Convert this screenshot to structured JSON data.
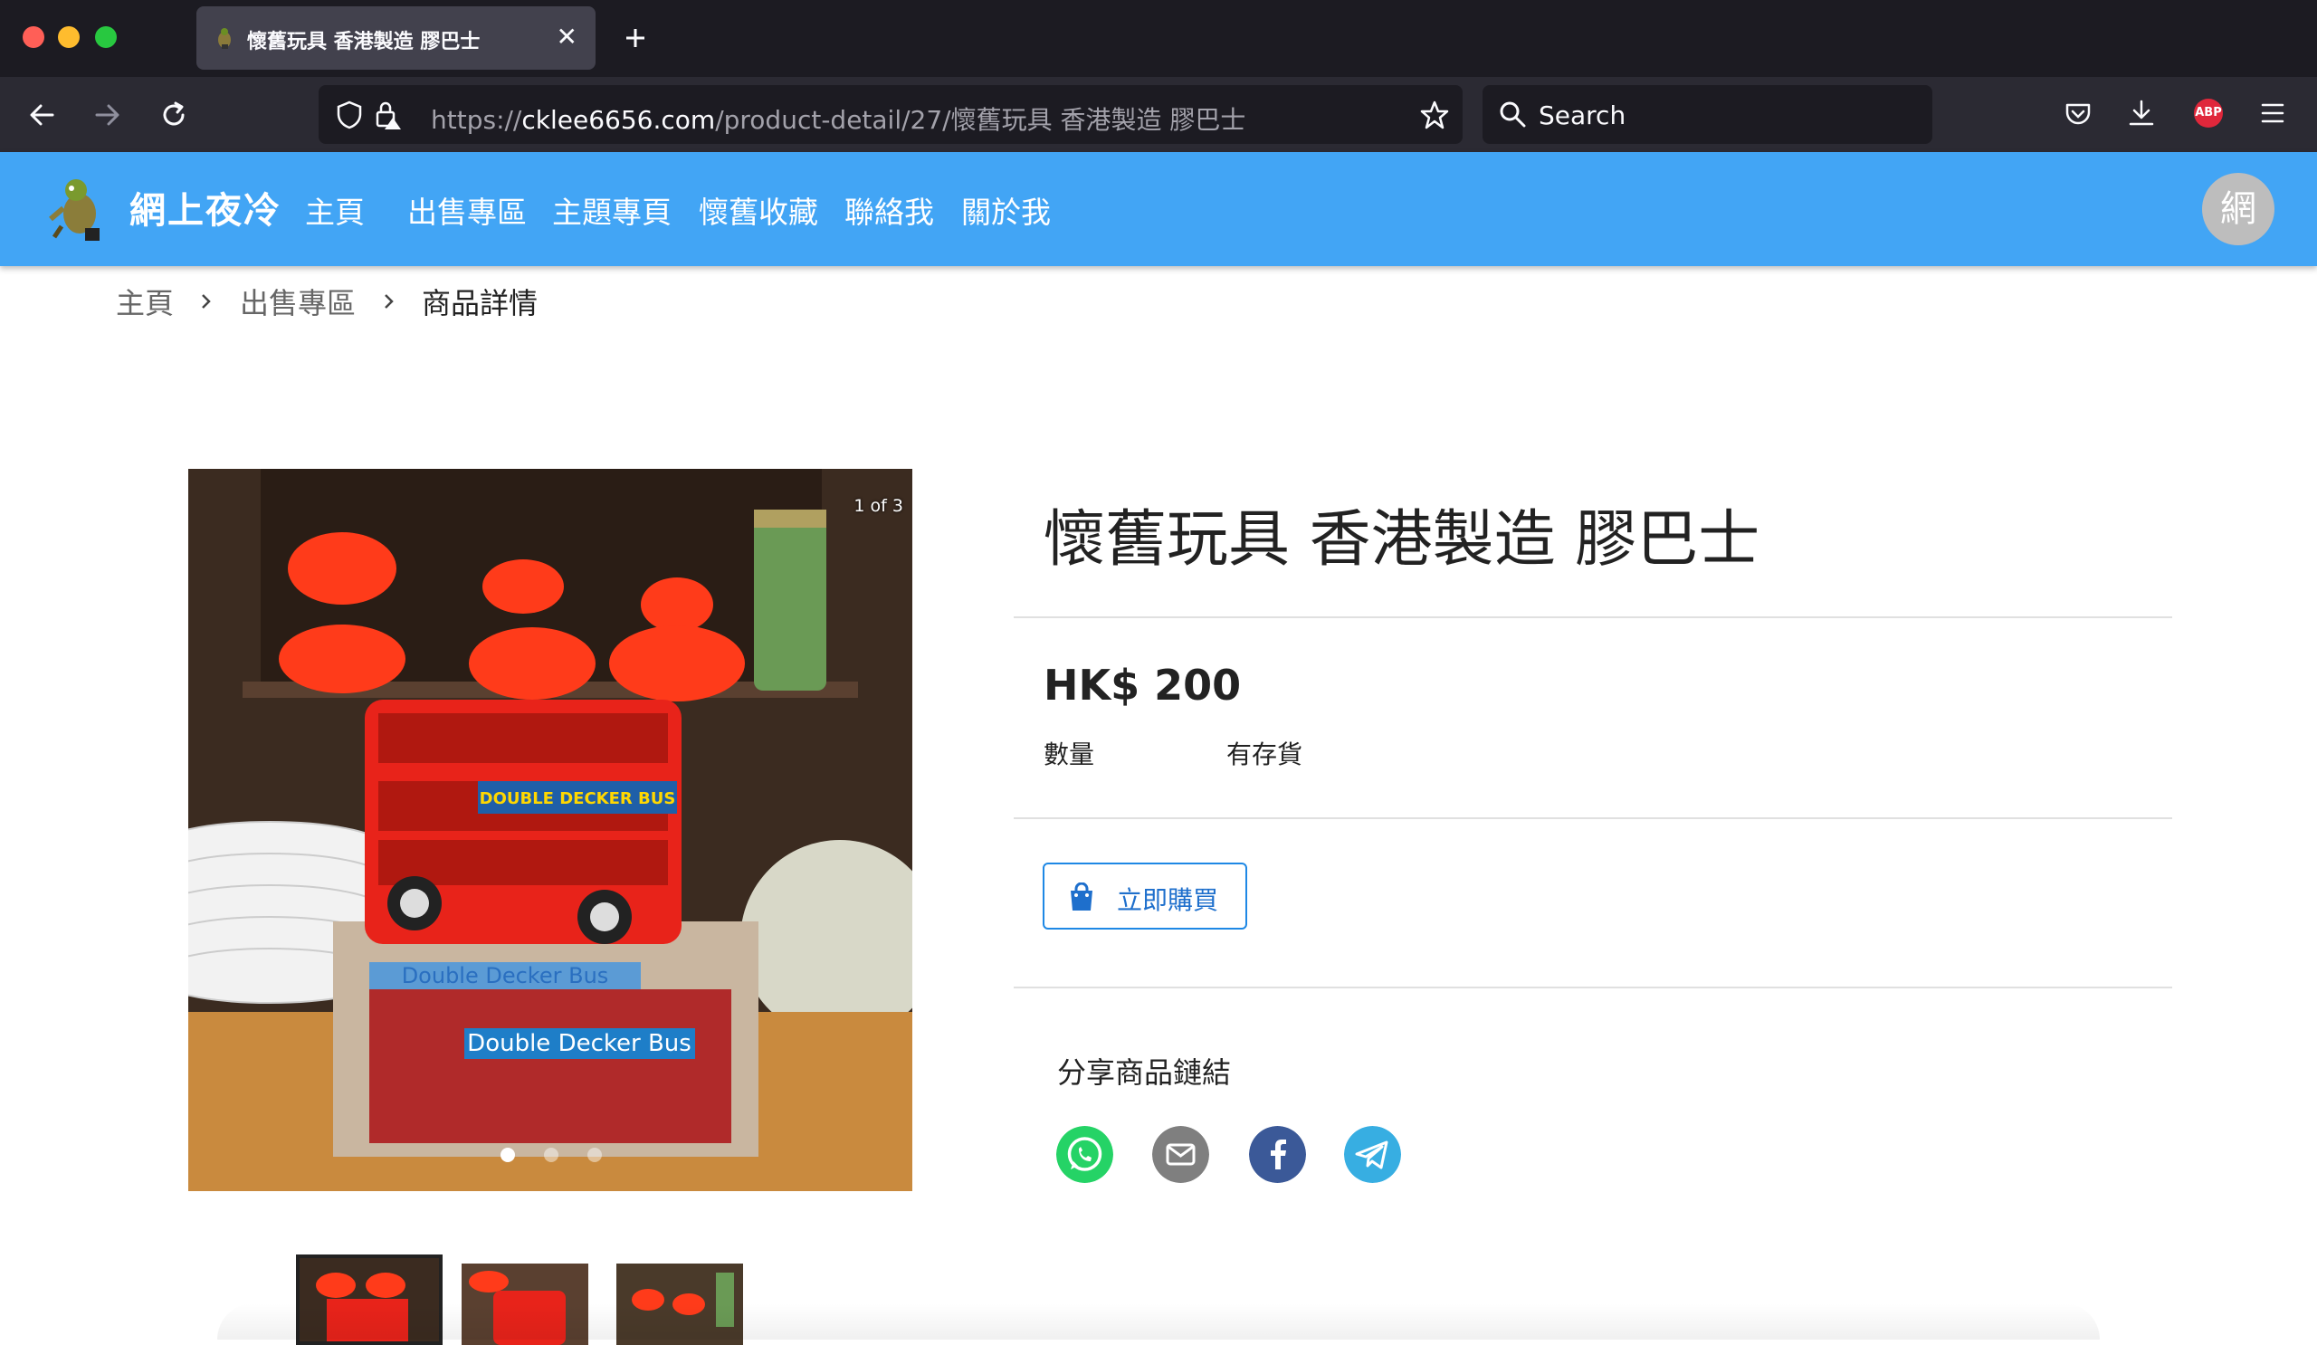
{
  "browser": {
    "tab_title": "懷舊玩具 香港製造 膠巴士",
    "url_prefix": "https://",
    "url_host": "cklee6656.com",
    "url_path": "/product-detail/27/懷舊玩具 香港製造 膠巴士",
    "search_placeholder": "Search",
    "abp_label": "ABP"
  },
  "site": {
    "name": "網上夜冷",
    "nav": [
      "主頁",
      "出售專區",
      "主題專頁",
      "懷舊收藏",
      "聯絡我",
      "關於我"
    ],
    "avatar_initial": "網",
    "header_color": "#42a5f5"
  },
  "breadcrumb": {
    "items": [
      "主頁",
      "出售專區",
      "商品詳情"
    ]
  },
  "gallery": {
    "counter": "1 of 3",
    "current_index": 1,
    "total": 3,
    "main_image_desc": "red-double-decker-bus-toy-with-box",
    "box_label_top": "Double Decker Bus",
    "box_label_bottom": "Double Decker Bus",
    "bus_sign": "DOUBLE DECKER BUS"
  },
  "product": {
    "title": "懷舊玩具 香港製造 膠巴士",
    "price": "HK$ 200",
    "quantity_label": "數量",
    "stock_status": "有存貨",
    "buy_button": "立即購買",
    "share_title": "分享商品鏈結",
    "share_icons": [
      "whatsapp-icon",
      "email-icon",
      "facebook-icon",
      "telegram-icon"
    ],
    "accent_color": "#1e88e5"
  }
}
